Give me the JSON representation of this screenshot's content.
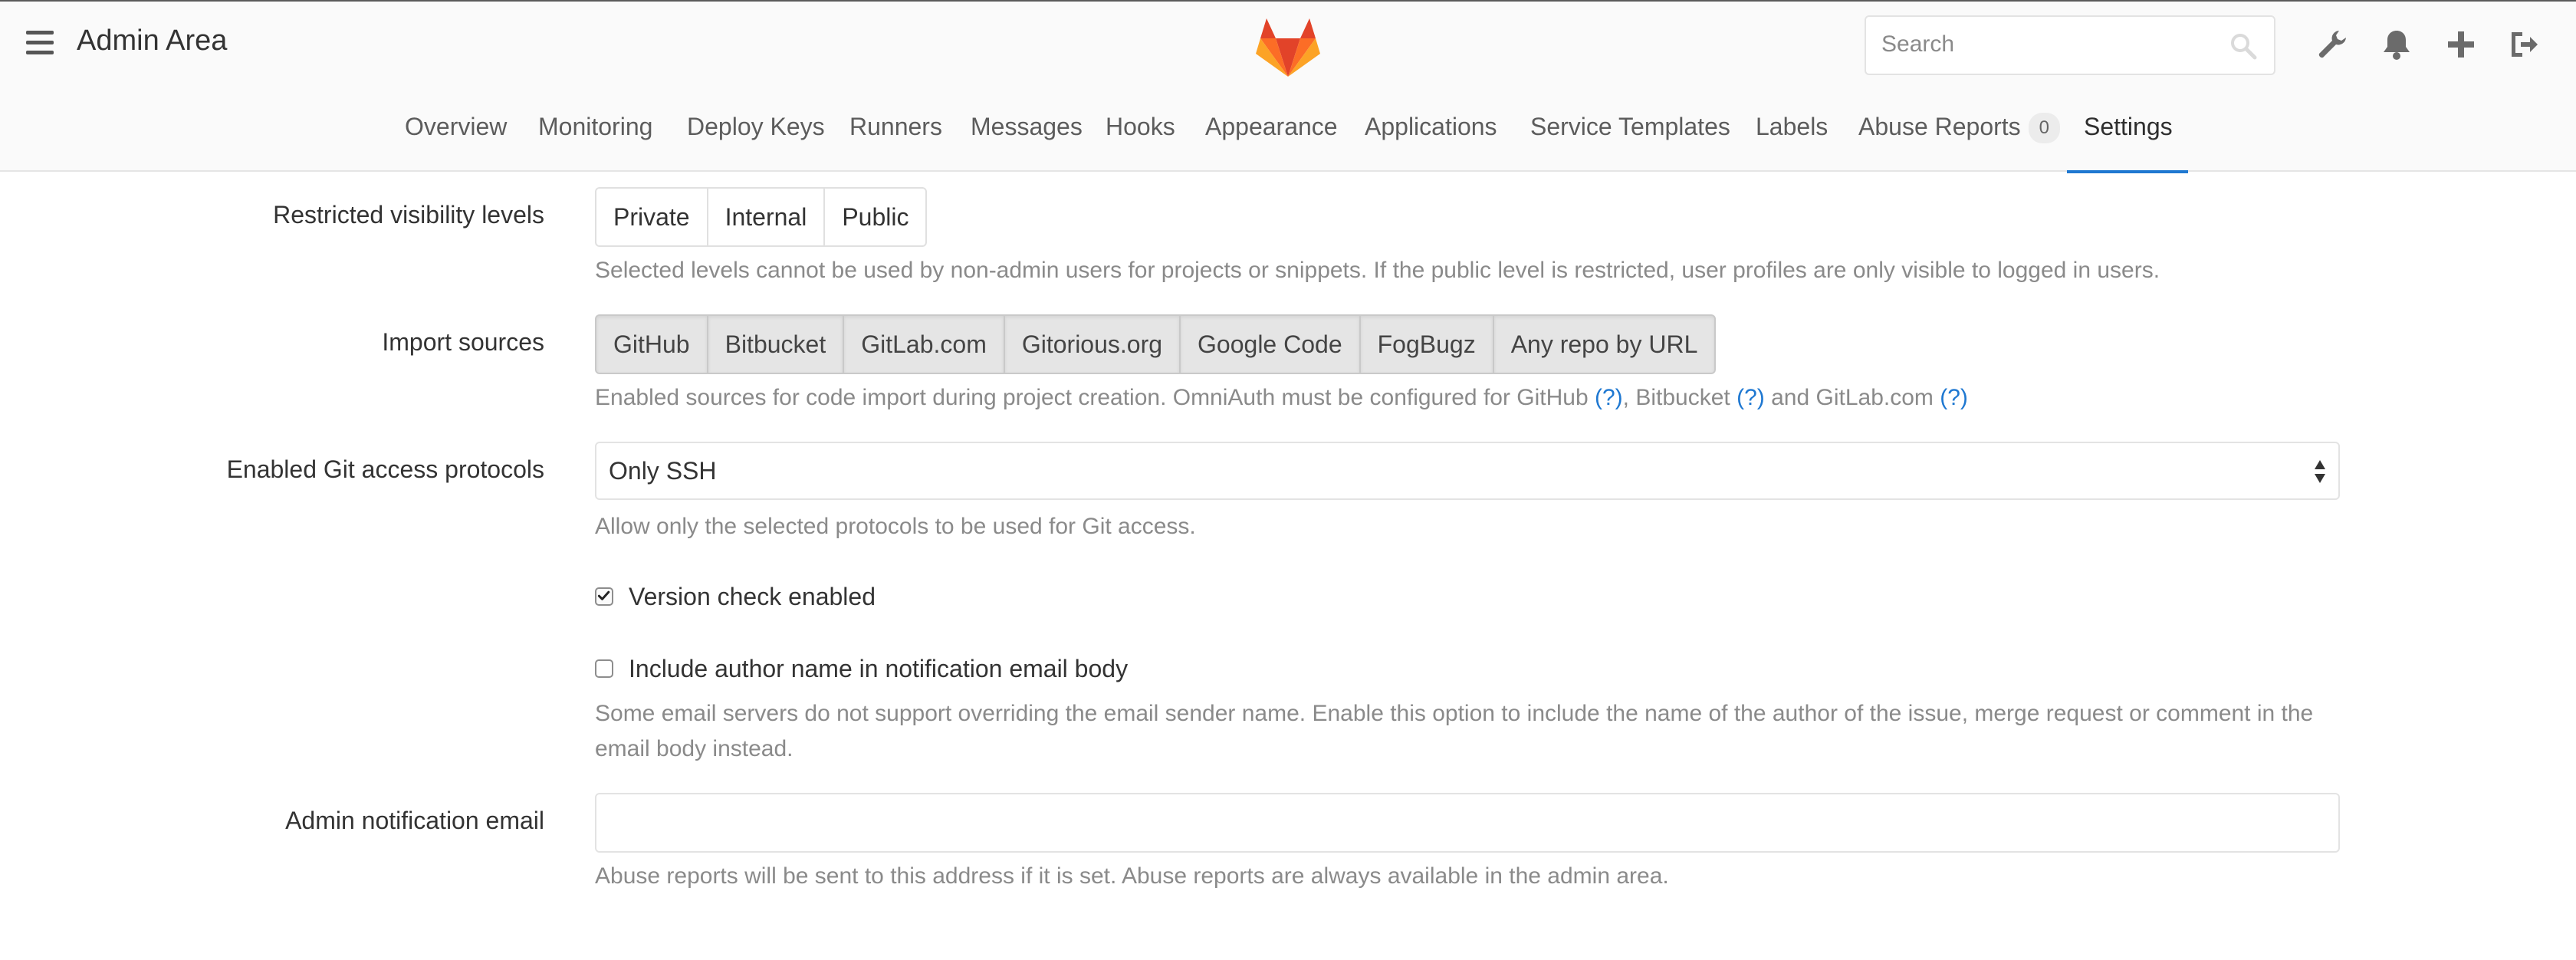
{
  "header": {
    "title": "Admin Area",
    "search_placeholder": "Search",
    "icons": [
      "hamburger-icon",
      "gitlab-logo",
      "search-icon",
      "wrench-icon",
      "bell-icon",
      "plus-icon",
      "sign-out-icon"
    ]
  },
  "nav": {
    "tabs": [
      {
        "label": "Overview"
      },
      {
        "label": "Monitoring"
      },
      {
        "label": "Deploy Keys"
      },
      {
        "label": "Runners"
      },
      {
        "label": "Messages"
      },
      {
        "label": "Hooks"
      },
      {
        "label": "Appearance"
      },
      {
        "label": "Applications"
      },
      {
        "label": "Service Templates"
      },
      {
        "label": "Labels"
      },
      {
        "label": "Abuse Reports",
        "badge": "0"
      },
      {
        "label": "Settings",
        "active": true
      }
    ]
  },
  "form": {
    "visibility": {
      "label": "Restricted visibility levels",
      "options": [
        "Private",
        "Internal",
        "Public"
      ],
      "help": "Selected levels cannot be used by non-admin users for projects or snippets. If the public level is restricted, user profiles are only visible to logged in users."
    },
    "import_sources": {
      "label": "Import sources",
      "options": [
        "GitHub",
        "Bitbucket",
        "GitLab.com",
        "Gitorious.org",
        "Google Code",
        "FogBugz",
        "Any repo by URL"
      ],
      "help_prefix": "Enabled sources for code import during project creation. OmniAuth must be configured for GitHub",
      "help_link": "(?)",
      "help_mid1": ", Bitbucket",
      "help_mid2": "and GitLab.com"
    },
    "git_access": {
      "label": "Enabled Git access protocols",
      "value": "Only SSH",
      "help": "Allow only the selected protocols to be used for Git access."
    },
    "version_check": {
      "label": "Version check enabled",
      "checked": true
    },
    "author_name": {
      "label": "Include author name in notification email body",
      "checked": false,
      "help": "Some email servers do not support overriding the email sender name. Enable this option to include the name of the author of the issue, merge request or comment in the email body instead."
    },
    "admin_email": {
      "label": "Admin notification email",
      "value": "",
      "help": "Abuse reports will be sent to this address if it is set. Abuse reports are always available in the admin area."
    }
  },
  "colors": {
    "link": "#1f78d1",
    "active_tab_underline": "#1f78d1",
    "help_text": "#8a8a8a",
    "logo_orange": "#fc6d26",
    "logo_red": "#e24329",
    "logo_amber": "#fca326"
  }
}
